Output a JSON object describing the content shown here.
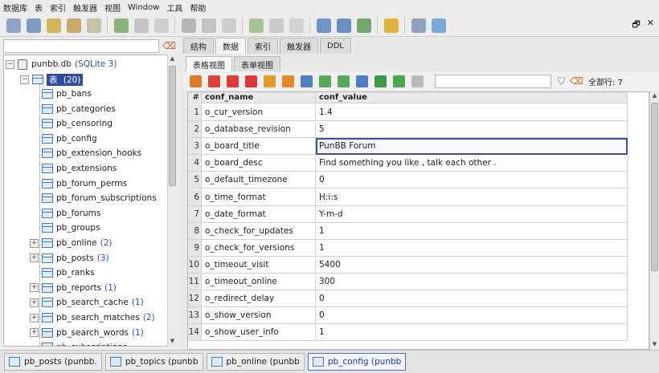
{
  "menu": [
    "数据库",
    "表",
    "索引",
    "触发器",
    "视图",
    "Window",
    "工具",
    "帮助"
  ],
  "search": {
    "placeholder": "",
    "value": ""
  },
  "tree": {
    "db": {
      "label": "punbb.db",
      "count": "(SQLite 3)"
    },
    "tables_node": {
      "label": "表",
      "count": "(20)"
    },
    "tables": [
      {
        "label": "pb_bans",
        "expandable": false,
        "count": ""
      },
      {
        "label": "pb_categories",
        "expandable": false,
        "count": ""
      },
      {
        "label": "pb_censoring",
        "expandable": false,
        "count": ""
      },
      {
        "label": "pb_config",
        "expandable": false,
        "count": ""
      },
      {
        "label": "pb_extension_hooks",
        "expandable": false,
        "count": ""
      },
      {
        "label": "pb_extensions",
        "expandable": false,
        "count": ""
      },
      {
        "label": "pb_forum_perms",
        "expandable": false,
        "count": ""
      },
      {
        "label": "pb_forum_subscriptions",
        "expandable": false,
        "count": ""
      },
      {
        "label": "pb_forums",
        "expandable": false,
        "count": ""
      },
      {
        "label": "pb_groups",
        "expandable": false,
        "count": ""
      },
      {
        "label": "pb_online",
        "expandable": true,
        "count": "(2)"
      },
      {
        "label": "pb_posts",
        "expandable": true,
        "count": "(3)"
      },
      {
        "label": "pb_ranks",
        "expandable": false,
        "count": ""
      },
      {
        "label": "pb_reports",
        "expandable": true,
        "count": "(1)"
      },
      {
        "label": "pb_search_cache",
        "expandable": true,
        "count": "(1)"
      },
      {
        "label": "pb_search_matches",
        "expandable": true,
        "count": "(2)"
      },
      {
        "label": "pb_search_words",
        "expandable": true,
        "count": "(1)"
      },
      {
        "label": "pb_subscriptions",
        "expandable": false,
        "count": ""
      }
    ]
  },
  "tabs": [
    "结构",
    "数据",
    "索引",
    "触发器",
    "DDL"
  ],
  "active_tab": 1,
  "subtabs": [
    "表格视图",
    "表单视图"
  ],
  "active_subtab": 0,
  "filter": {
    "value": ""
  },
  "row_count": "全部行: 7",
  "grid": {
    "headers": [
      "#",
      "conf_name",
      "conf_value"
    ],
    "rows": [
      [
        "1",
        "o_cur_version",
        "1.4"
      ],
      [
        "2",
        "o_database_revision",
        "5"
      ],
      [
        "3",
        "o_board_title",
        "PunBB Forum"
      ],
      [
        "4",
        "o_board_desc",
        "Find something you like , talk each other ."
      ],
      [
        "5",
        "o_default_timezone",
        "0"
      ],
      [
        "6",
        "o_time_format",
        "H:i:s"
      ],
      [
        "7",
        "o_date_format",
        "Y-m-d"
      ],
      [
        "8",
        "o_check_for_updates",
        "1"
      ],
      [
        "9",
        "o_check_for_versions",
        "1"
      ],
      [
        "10",
        "o_timeout_visit",
        "5400"
      ],
      [
        "11",
        "o_timeout_online",
        "300"
      ],
      [
        "12",
        "o_redirect_delay",
        "0"
      ],
      [
        "13",
        "o_show_version",
        "0"
      ],
      [
        "14",
        "o_show_user_info",
        "1"
      ]
    ]
  },
  "bottom_tabs": [
    "pb_posts (punbb.",
    "pb_topics (punbb",
    "pb_online (punbb",
    "pb_config (punbb"
  ],
  "active_bottom_tab": 3,
  "colors": {
    "selection": "#2f4c9c",
    "accent_blue": "#2850c8"
  }
}
